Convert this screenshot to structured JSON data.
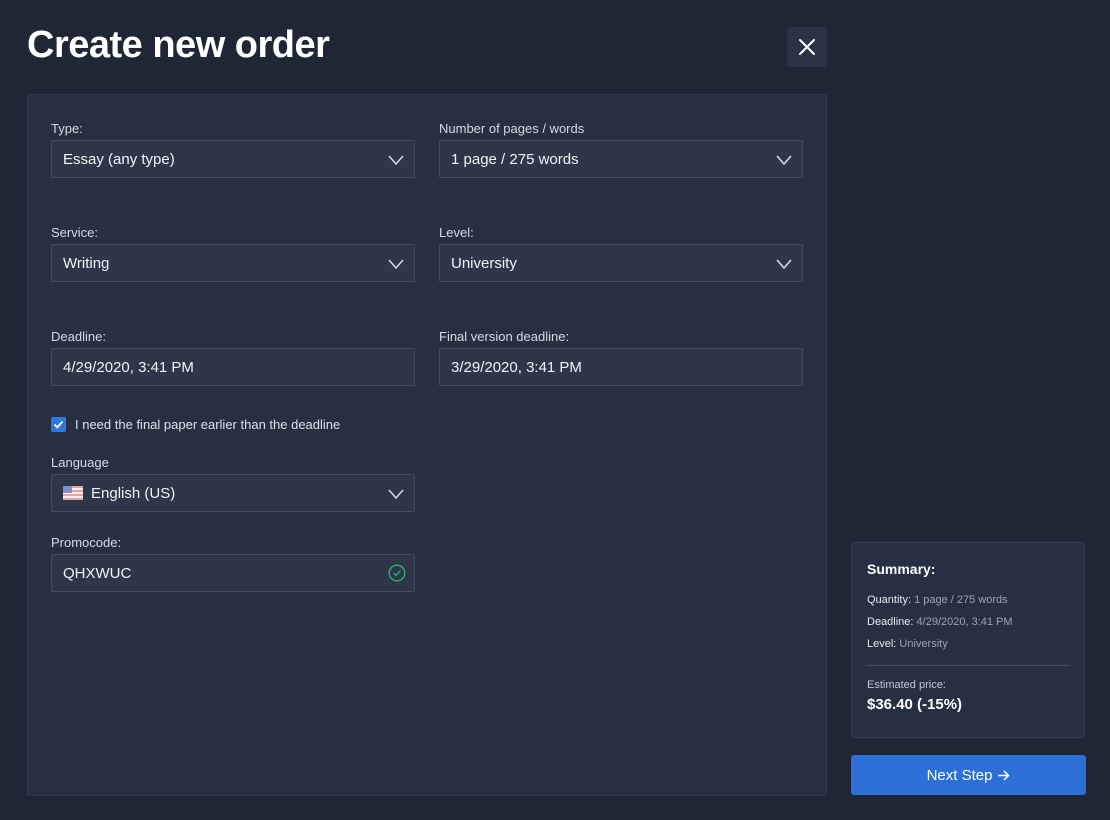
{
  "header": {
    "title": "Create new order"
  },
  "form": {
    "type": {
      "label": "Type:",
      "value": "Essay (any type)"
    },
    "pages": {
      "label": "Number of pages / words",
      "value": "1 page / 275 words"
    },
    "service": {
      "label": "Service:",
      "value": "Writing"
    },
    "level": {
      "label": "Level:",
      "value": "University"
    },
    "deadline": {
      "label": "Deadline:",
      "value": "4/29/2020, 3:41 PM"
    },
    "final_deadline": {
      "label": "Final version deadline:",
      "value": "3/29/2020, 3:41 PM"
    },
    "earlier_checkbox": {
      "label": "I need the final paper earlier than the deadline",
      "checked": true
    },
    "language": {
      "label": "Language",
      "value": "English (US)",
      "flag_icon": "us-flag-icon"
    },
    "promocode": {
      "label": "Promocode:",
      "value": "QHXWUC",
      "status_icon": "check-circle-icon",
      "status_color": "#2bb673"
    }
  },
  "summary": {
    "title": "Summary:",
    "quantity_key": "Quantity:",
    "quantity_value": "1 page / 275 words",
    "deadline_key": "Deadline:",
    "deadline_value": "4/29/2020, 3:41 PM",
    "level_key": "Level:",
    "level_value": "University",
    "estimated_label": "Estimated price:",
    "estimated_price": "$36.40 (-15%)"
  },
  "actions": {
    "next_label": "Next Step",
    "next_icon": "arrow-right-icon",
    "close_icon": "close-icon"
  },
  "colors": {
    "background": "#1f2736",
    "panel": "#273042",
    "accent": "#2c6fd6"
  }
}
